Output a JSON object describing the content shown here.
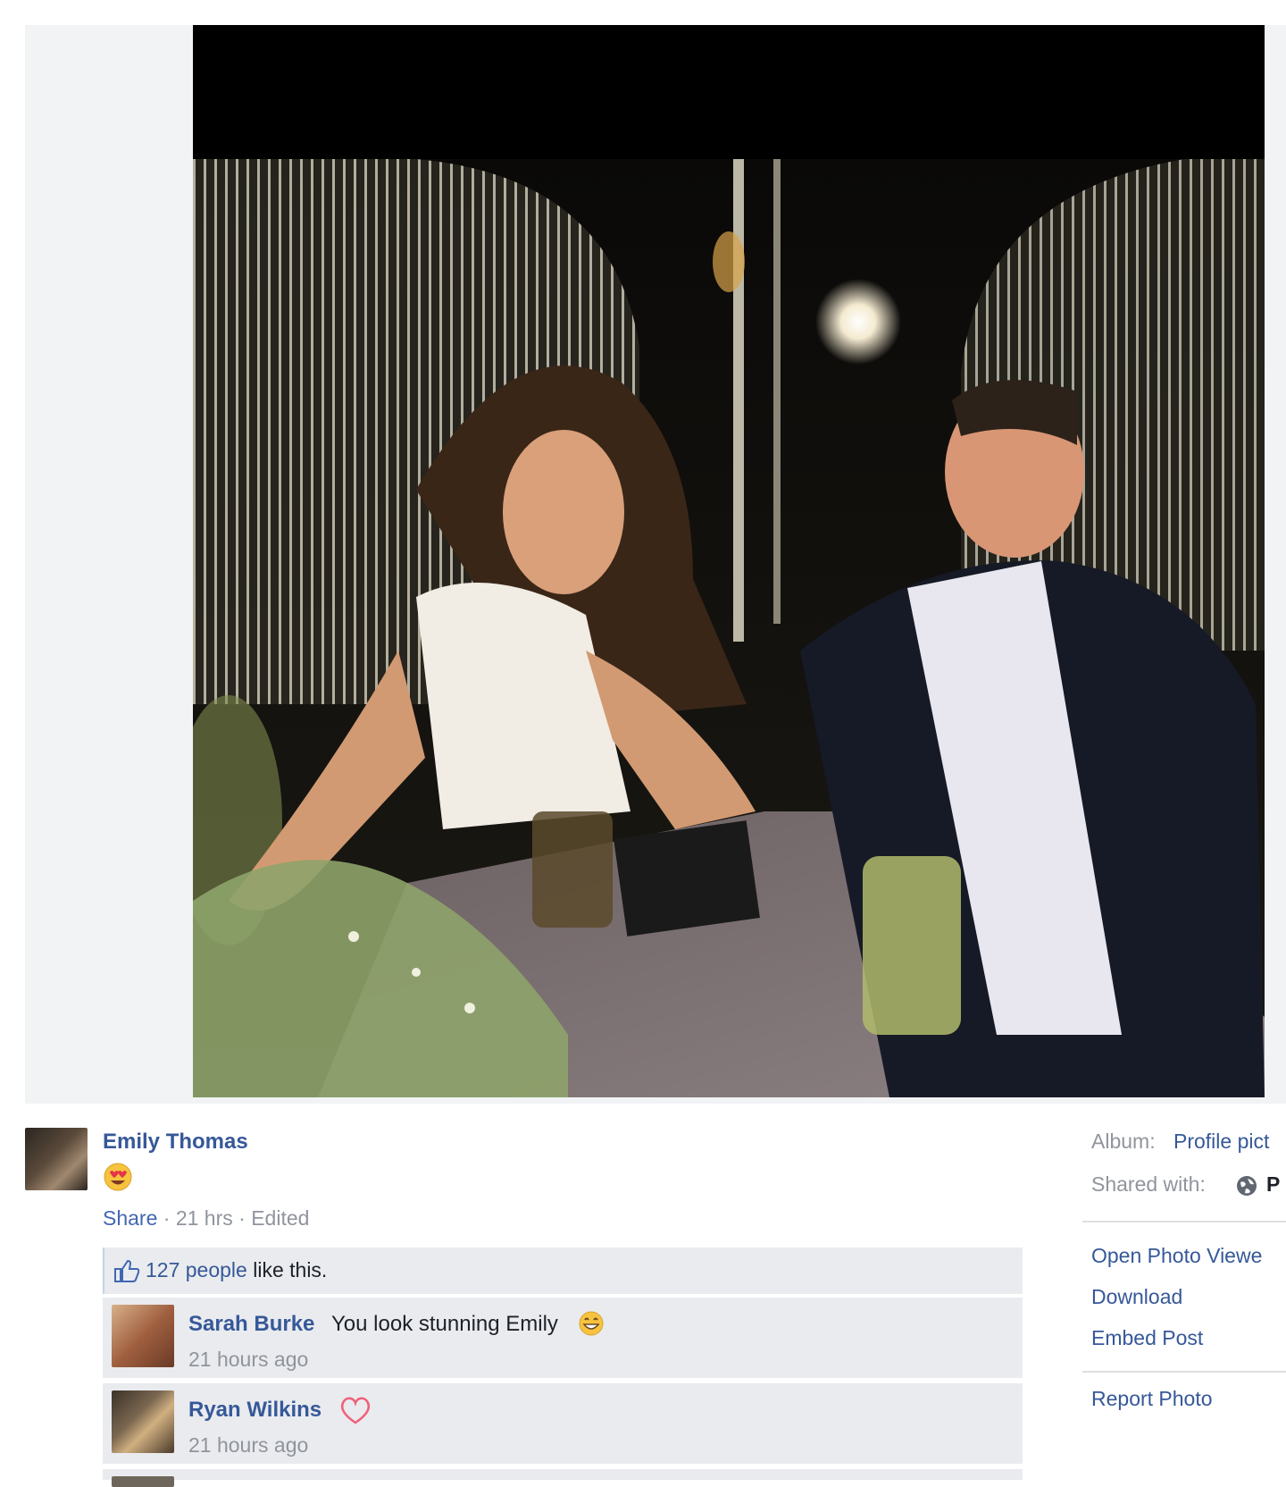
{
  "post": {
    "author": "Emily Thomas",
    "share_label": "Share",
    "time": "21 hrs",
    "edited": "Edited",
    "likes_count_text": "127 people",
    "likes_suffix": "like this."
  },
  "comments": [
    {
      "name": "Sarah Burke",
      "text": "You look stunning Emily",
      "time": "21 hours ago"
    },
    {
      "name": "Ryan Wilkins",
      "text": "",
      "time": "21 hours ago"
    }
  ],
  "sidebar": {
    "album_label": "Album:",
    "album_value": "Profile pict",
    "shared_label": "Shared with:",
    "shared_value": "P",
    "actions": [
      "Open Photo Viewe",
      "Download",
      "Embed Post",
      "Report Photo"
    ]
  },
  "colors": {
    "link": "#365899",
    "muted": "#90949c",
    "comment_bg": "#e9ebee"
  },
  "icons": [
    "heart-eyes-emoji-icon",
    "thumbs-up-icon",
    "grin-emoji-icon",
    "heart-icon",
    "globe-icon"
  ]
}
